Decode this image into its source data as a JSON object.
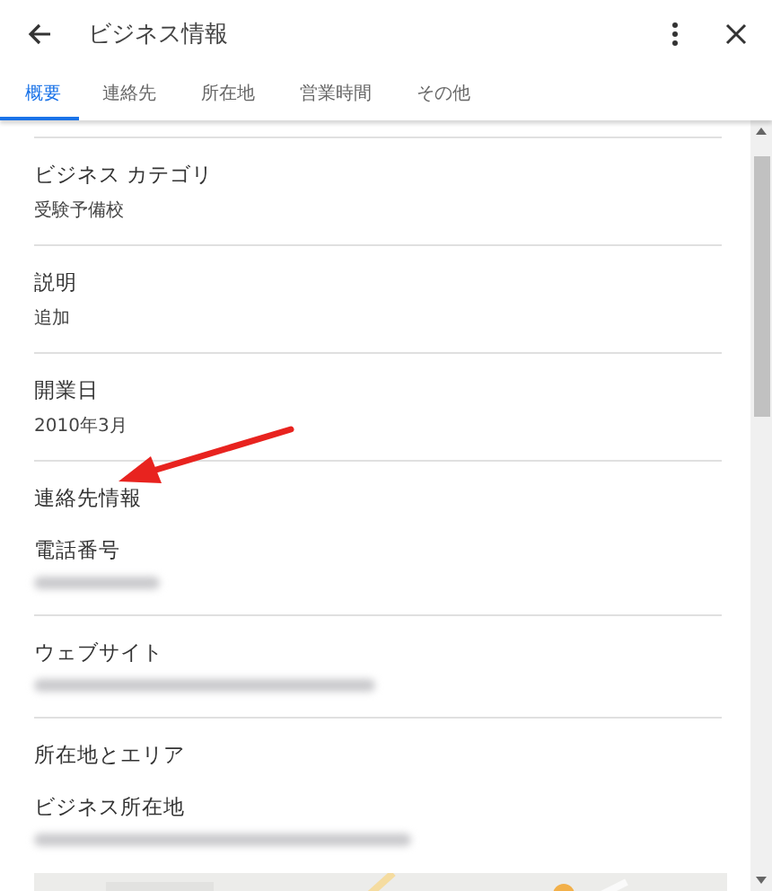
{
  "header": {
    "title": "ビジネス情報"
  },
  "tabs": [
    {
      "label": "概要",
      "selected": true
    },
    {
      "label": "連絡先",
      "selected": false
    },
    {
      "label": "所在地",
      "selected": false
    },
    {
      "label": "営業時間",
      "selected": false
    },
    {
      "label": "その他",
      "selected": false
    }
  ],
  "groups": [
    {
      "rows": [
        {
          "kind": "field",
          "label": "ビジネス カテゴリ",
          "value": "受験予備校"
        }
      ]
    },
    {
      "rows": [
        {
          "kind": "field",
          "label": "説明",
          "value": "追加"
        }
      ]
    },
    {
      "rows": [
        {
          "kind": "field",
          "label": "開業日",
          "value": "2010年3月"
        }
      ]
    },
    {
      "rows": [
        {
          "kind": "heading",
          "label": "連絡先情報"
        },
        {
          "kind": "blurred",
          "label": "電話番号"
        }
      ]
    },
    {
      "rows": [
        {
          "kind": "blurred",
          "label": "ウェブサイト"
        }
      ]
    },
    {
      "rows": [
        {
          "kind": "heading",
          "label": "所在地とエリア"
        },
        {
          "kind": "blurred",
          "label": "ビジネス所在地"
        },
        {
          "kind": "map"
        }
      ]
    }
  ]
}
